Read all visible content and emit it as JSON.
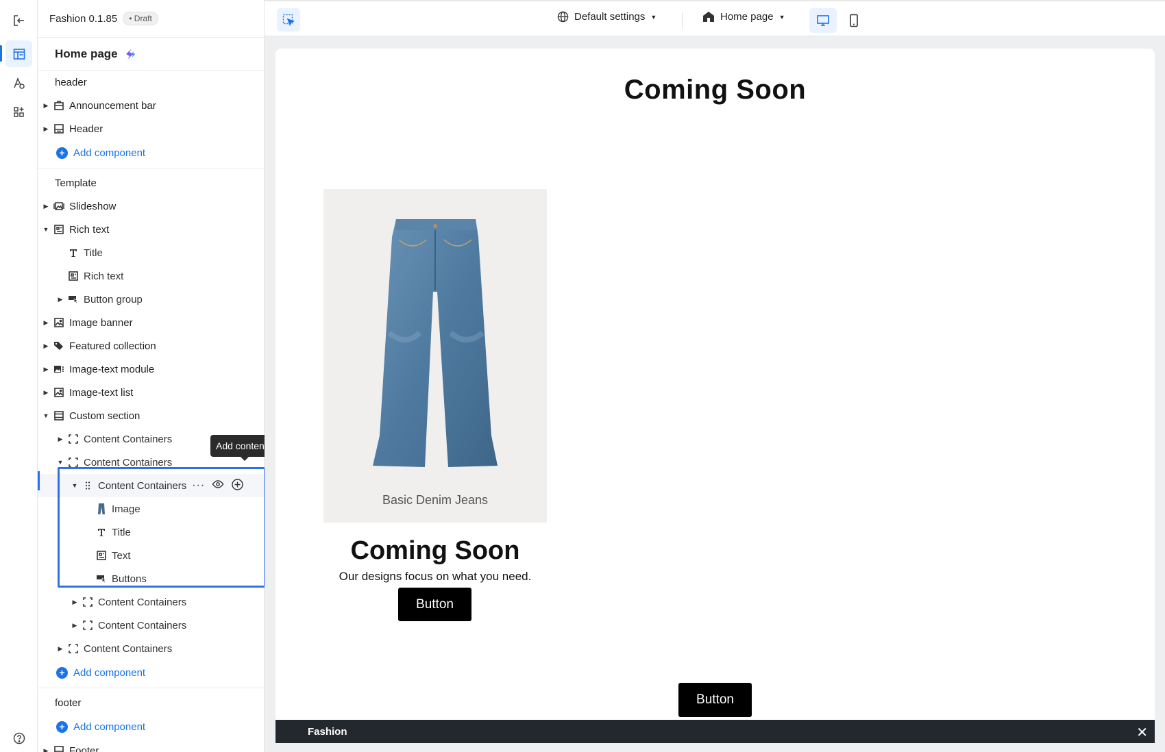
{
  "app": {
    "name": "Fashion 0.1.85",
    "status": "Draft"
  },
  "sidebar": {
    "page_title": "Home page",
    "header_group": {
      "label": "header",
      "items": [
        {
          "label": "Announcement bar",
          "icon": "announcement-icon"
        },
        {
          "label": "Header",
          "icon": "header-layout-icon"
        }
      ],
      "add_label": "Add component"
    },
    "template_group": {
      "label": "Template",
      "items": [
        {
          "label": "Slideshow"
        },
        {
          "label": "Rich text"
        },
        {
          "label": "Title"
        },
        {
          "label": "Rich text"
        },
        {
          "label": "Button group"
        },
        {
          "label": "Image banner"
        },
        {
          "label": "Featured collection"
        },
        {
          "label": "Image-text module"
        },
        {
          "label": "Image-text list"
        },
        {
          "label": "Custom section"
        },
        {
          "label": "Content Containers"
        },
        {
          "label": "Content Containers"
        },
        {
          "label": "Content Containers"
        },
        {
          "label": "Image"
        },
        {
          "label": "Title"
        },
        {
          "label": "Text"
        },
        {
          "label": "Buttons"
        },
        {
          "label": "Content Containers"
        },
        {
          "label": "Content Containers"
        },
        {
          "label": "Content Containers"
        }
      ],
      "add_label": "Add component"
    },
    "footer_group": {
      "label": "footer",
      "add_label": "Add component",
      "items": [
        {
          "label": "Footer"
        }
      ]
    },
    "tooltip": "Add content"
  },
  "toolbar": {
    "settings_label": "Default settings",
    "page_select": "Home page"
  },
  "preview": {
    "main_title": "Coming Soon",
    "image_caption": "Basic Denim Jeans",
    "card_title": "Coming Soon",
    "card_text": "Our designs focus on what you need.",
    "card_button": "Button",
    "center_button": "Button",
    "bottom_bar_label": "Fashion"
  },
  "colors": {
    "accent": "#1a73e8",
    "selection": "#2f6fed",
    "bar": "#23272e"
  }
}
